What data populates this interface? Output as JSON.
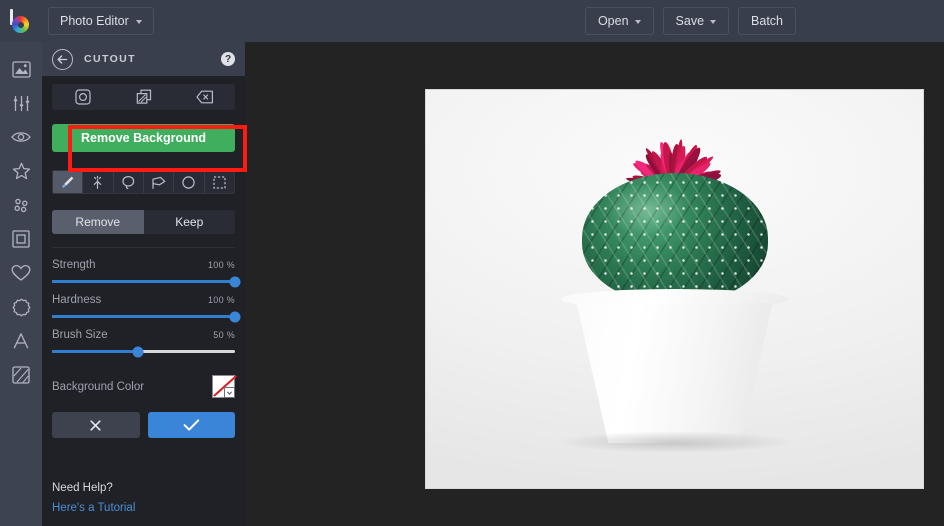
{
  "app": {
    "brand_icon": "befunky-logo-icon",
    "menu_label": "Photo Editor"
  },
  "topbar": {
    "open_label": "Open",
    "save_label": "Save",
    "batch_label": "Batch"
  },
  "sidebar": {
    "items": [
      {
        "name": "image-tools",
        "icon": "image-icon"
      },
      {
        "name": "edit-adjust",
        "icon": "sliders-icon"
      },
      {
        "name": "touch-up",
        "icon": "eye-icon"
      },
      {
        "name": "effects",
        "icon": "star-icon"
      },
      {
        "name": "artsy",
        "icon": "dots-icon"
      },
      {
        "name": "frames",
        "icon": "frame-icon"
      },
      {
        "name": "overlays",
        "icon": "heart-icon"
      },
      {
        "name": "graphics",
        "icon": "badge-icon"
      },
      {
        "name": "text",
        "icon": "text-a-icon"
      },
      {
        "name": "textures",
        "icon": "texture-icon"
      }
    ]
  },
  "panel": {
    "back_icon": "back-arrow-icon",
    "title": "CUTOUT",
    "help_icon": "question-mark-icon",
    "icon_row": [
      {
        "name": "cutout-shape",
        "icon": "rounded-square-circle-icon"
      },
      {
        "name": "cutout-layers",
        "icon": "layers-icon"
      },
      {
        "name": "cutout-erase",
        "icon": "backspace-erase-icon"
      }
    ],
    "remove_background_label": "Remove Background",
    "tools": [
      {
        "name": "brush-tool",
        "icon": "brush-icon",
        "active": true
      },
      {
        "name": "magic-wand-tool",
        "icon": "magic-wand-icon",
        "active": false
      },
      {
        "name": "lasso-tool",
        "icon": "lasso-icon",
        "active": false
      },
      {
        "name": "polygon-lasso-tool",
        "icon": "polygon-lasso-icon",
        "active": false
      },
      {
        "name": "ellipse-select-tool",
        "icon": "ellipse-icon",
        "active": false
      },
      {
        "name": "rectangle-select-tool",
        "icon": "marquee-icon",
        "active": false
      }
    ],
    "mode": {
      "remove_label": "Remove",
      "keep_label": "Keep",
      "selected": "Remove"
    },
    "sliders": [
      {
        "label": "Strength",
        "value": "100 %",
        "percent": 100
      },
      {
        "label": "Hardness",
        "value": "100 %",
        "percent": 100
      },
      {
        "label": "Brush Size",
        "value": "50 %",
        "percent": 47
      }
    ],
    "background_color": {
      "label": "Background Color",
      "swatch": "transparent-white-red-slash",
      "dropdown_icon": "chevron-down-icon"
    },
    "actions": {
      "cancel_icon": "close-x-icon",
      "confirm_icon": "check-icon"
    },
    "help": {
      "title": "Need Help?",
      "link_label": "Here's a Tutorial"
    }
  },
  "canvas": {
    "subject": "potted-cactus-with-pink-flower",
    "annotation_color": "#ff1a14"
  },
  "colors": {
    "topbar_bg": "#393e4c",
    "rail_bg": "#3e4351",
    "panel_bg": "#202127",
    "workspace_bg": "#232323",
    "accent_green": "#3fae5d",
    "accent_blue": "#3a85d8",
    "annotation_red": "#ff1a14"
  }
}
